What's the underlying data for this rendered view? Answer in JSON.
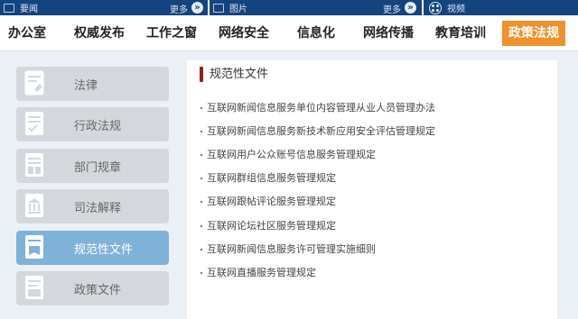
{
  "top_strip": {
    "seg1": {
      "title": "要闻",
      "more": "更多"
    },
    "seg2": {
      "title": "图片",
      "more": "更多"
    },
    "seg3": {
      "title": "视频"
    }
  },
  "nav": {
    "items": [
      {
        "label": "办公室"
      },
      {
        "label": "权威发布"
      },
      {
        "label": "工作之窗"
      },
      {
        "label": "网络安全"
      },
      {
        "label": "信息化"
      },
      {
        "label": "网络传播"
      },
      {
        "label": "教育培训"
      },
      {
        "label": "政策法规"
      }
    ],
    "active_index": 7,
    "active_color": "#f0912b"
  },
  "sidebar": {
    "items": [
      {
        "label": "法律",
        "icon": "law-document-icon"
      },
      {
        "label": "行政法规",
        "icon": "regulation-check-icon"
      },
      {
        "label": "部门规章",
        "icon": "department-document-icon"
      },
      {
        "label": "司法解释",
        "icon": "court-building-icon"
      },
      {
        "label": "规范性文件",
        "icon": "normative-document-icon"
      },
      {
        "label": "政策文件",
        "icon": "policy-document-icon"
      }
    ],
    "active_index": 4,
    "active_color": "#7fb2d9"
  },
  "section": {
    "title": "规范性文件",
    "accent_color": "#9b1d1d",
    "documents": [
      "互联网新闻信息服务单位内容管理从业人员管理办法",
      "互联网新闻信息服务新技术新应用安全评估管理规定",
      "互联网用户公众账号信息服务管理规定",
      "互联网群组信息服务管理规定",
      "互联网跟帖评论服务管理规定",
      "互联网论坛社区服务管理规定",
      "互联网新闻信息服务许可管理实施细则",
      "互联网直播服务管理规定"
    ]
  }
}
